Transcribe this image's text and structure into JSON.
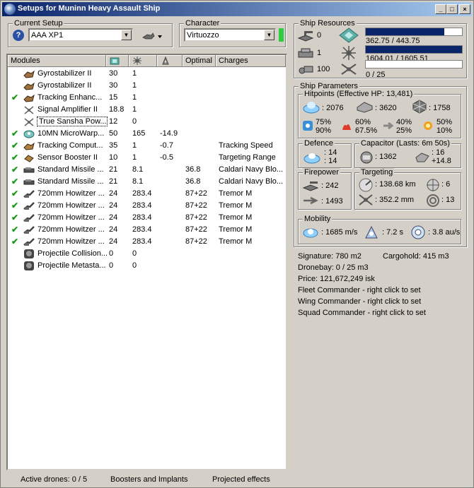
{
  "window": {
    "title": "Setups for Muninn Heavy Assault Ship"
  },
  "setup": {
    "label": "Current Setup",
    "value": "AAA XP1"
  },
  "character": {
    "label": "Character",
    "value": "Virtuozzo",
    "status_color": "#2ecc40"
  },
  "modules_table": {
    "headers": [
      "Modules",
      "cpu-icon",
      "powergrid-icon",
      "speed-icon",
      "Optimal",
      "Charges"
    ],
    "rows": [
      {
        "checked": false,
        "icon": "gyrostabilizer-icon",
        "name": "Gyrostabilizer II",
        "cpu": "30",
        "pg": "1",
        "speed": "",
        "optimal": "",
        "charges": ""
      },
      {
        "checked": false,
        "icon": "gyrostabilizer-icon",
        "name": "Gyrostabilizer II",
        "cpu": "30",
        "pg": "1",
        "speed": "",
        "optimal": "",
        "charges": ""
      },
      {
        "checked": true,
        "icon": "tracking-enhancer-icon",
        "name": "Tracking Enhanc...",
        "cpu": "15",
        "pg": "1",
        "speed": "",
        "optimal": "",
        "charges": ""
      },
      {
        "checked": false,
        "icon": "signal-amplifier-icon",
        "name": "Signal Amplifier II",
        "cpu": "18.8",
        "pg": "1",
        "speed": "",
        "optimal": "",
        "charges": ""
      },
      {
        "checked": false,
        "icon": "signal-amplifier-icon",
        "name": "True Sansha Pow...",
        "cpu": "12",
        "pg": "0",
        "speed": "",
        "optimal": "",
        "charges": "",
        "selected": true
      },
      {
        "checked": true,
        "icon": "microwarpdrive-icon",
        "name": "10MN MicroWarp...",
        "cpu": "50",
        "pg": "165",
        "speed": "-14.9",
        "optimal": "",
        "charges": ""
      },
      {
        "checked": true,
        "icon": "tracking-computer-icon",
        "name": "Tracking Comput...",
        "cpu": "35",
        "pg": "1",
        "speed": "-0.7",
        "optimal": "",
        "charges": "Tracking Speed"
      },
      {
        "checked": true,
        "icon": "sensor-booster-icon",
        "name": "Sensor Booster II",
        "cpu": "10",
        "pg": "1",
        "speed": "-0.5",
        "optimal": "",
        "charges": "Targeting Range"
      },
      {
        "checked": true,
        "icon": "missile-launcher-icon",
        "name": "Standard Missile ...",
        "cpu": "21",
        "pg": "8.1",
        "speed": "",
        "optimal": "36.8",
        "charges": "Caldari Navy Blo..."
      },
      {
        "checked": true,
        "icon": "missile-launcher-icon",
        "name": "Standard Missile ...",
        "cpu": "21",
        "pg": "8.1",
        "speed": "",
        "optimal": "36.8",
        "charges": "Caldari Navy Blo..."
      },
      {
        "checked": true,
        "icon": "howitzer-icon",
        "name": "720mm Howitzer ...",
        "cpu": "24",
        "pg": "283.4",
        "speed": "",
        "optimal": "87+22",
        "charges": "Tremor M"
      },
      {
        "checked": true,
        "icon": "howitzer-icon",
        "name": "720mm Howitzer ...",
        "cpu": "24",
        "pg": "283.4",
        "speed": "",
        "optimal": "87+22",
        "charges": "Tremor M"
      },
      {
        "checked": true,
        "icon": "howitzer-icon",
        "name": "720mm Howitzer ...",
        "cpu": "24",
        "pg": "283.4",
        "speed": "",
        "optimal": "87+22",
        "charges": "Tremor M"
      },
      {
        "checked": true,
        "icon": "howitzer-icon",
        "name": "720mm Howitzer ...",
        "cpu": "24",
        "pg": "283.4",
        "speed": "",
        "optimal": "87+22",
        "charges": "Tremor M"
      },
      {
        "checked": true,
        "icon": "howitzer-icon",
        "name": "720mm Howitzer ...",
        "cpu": "24",
        "pg": "283.4",
        "speed": "",
        "optimal": "87+22",
        "charges": "Tremor M"
      },
      {
        "checked": false,
        "icon": "rig-icon",
        "name": "Projectile Collision...",
        "cpu": "0",
        "pg": "0",
        "speed": "",
        "optimal": "",
        "charges": ""
      },
      {
        "checked": false,
        "icon": "rig-icon",
        "name": "Projectile Metasta...",
        "cpu": "0",
        "pg": "0",
        "speed": "",
        "optimal": "",
        "charges": ""
      }
    ]
  },
  "resources": {
    "label": "Ship Resources",
    "hardpoints": {
      "turret": "0",
      "launcher": "1",
      "calibration": "100"
    },
    "cpu": {
      "text": "362.75 / 443.75",
      "fraction": 0.817
    },
    "powergrid": {
      "text": "1604.01 / 1605.51",
      "fraction": 0.999
    },
    "drones": {
      "text": "0 / 25",
      "fraction": 0.0
    }
  },
  "params": {
    "label": "Ship Parameters",
    "hitpoints": {
      "label": "Hitpoints (Effective HP: 13,481)",
      "shield": ": 2076",
      "armor": ": 3620",
      "structure": ": 1758",
      "res_em": "75%",
      "res_em2": "90%",
      "res_therm": "60%",
      "res_therm2": "67.5%",
      "res_kin": "40%",
      "res_kin2": "25%",
      "res_exp": "50%",
      "res_exp2": "10%"
    },
    "defence": {
      "label": "Defence",
      "a": ": 14",
      "b": ": 14"
    },
    "capacitor": {
      "label": "Capacitor (Lasts: 6m 50s)",
      "amount": ": 1362",
      "recharge_a": ": 16",
      "recharge_b": "+14.8"
    },
    "firepower": {
      "label": "Firepower",
      "turret": ": 242",
      "missile": ": 1493"
    },
    "targeting": {
      "label": "Targeting",
      "range": ": 138.68 km",
      "targets": ": 6",
      "scanres": ": 352.2 mm",
      "sig": ": 13"
    },
    "mobility": {
      "label": "Mobility",
      "speed": ": 1685 m/s",
      "align": ": 7.2 s",
      "warp": ": 3.8 au/s"
    }
  },
  "info": {
    "signature": "Signature: 780 m2",
    "cargohold": "Cargohold: 415 m3",
    "dronebay": "Dronebay: 0 / 25 m3",
    "price": "Price: 121,672,249 isk",
    "fleet": "Fleet Commander - right click to set",
    "wing": "Wing Commander - right click to set",
    "squad": "Squad Commander - right click to set"
  },
  "status": {
    "drones": "Active drones: 0 / 5",
    "boosters": "Boosters and Implants",
    "projected": "Projected effects"
  }
}
